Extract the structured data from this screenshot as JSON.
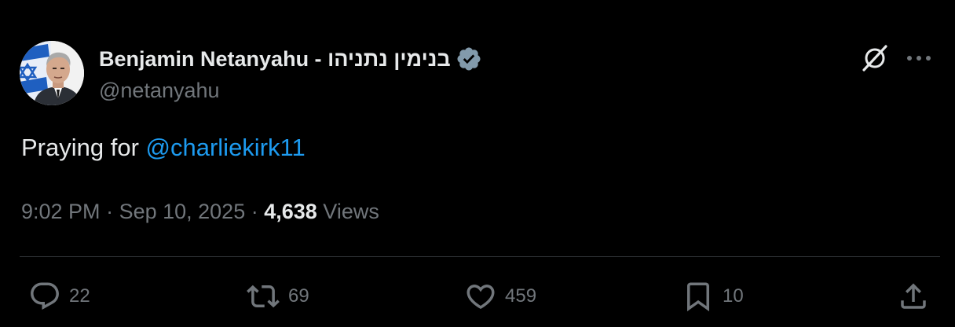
{
  "author": {
    "display_name": "Benjamin Netanyahu - בנימין נתניהו",
    "handle": "@netanyahu",
    "verified_color": "#829aab",
    "avatar_icon": "avatar-photo"
  },
  "tweet": {
    "text_prefix": "Praying for ",
    "mention": "@charliekirk11",
    "time": "9:02 PM",
    "separator1": " · ",
    "date": "Sep 10, 2025",
    "separator2": " · ",
    "views_count": "4,638",
    "views_label": " Views"
  },
  "actions": {
    "replies": "22",
    "reposts": "69",
    "likes": "459",
    "bookmarks": "10"
  },
  "icons": {
    "grok": "grok-icon",
    "more": "more-icon",
    "reply": "reply-icon",
    "repost": "repost-icon",
    "like": "heart-icon",
    "bookmark": "bookmark-icon",
    "share": "share-icon"
  },
  "colors": {
    "background": "#000000",
    "text": "#e7e9ea",
    "secondary": "#71767b",
    "link": "#1d9bf0",
    "divider": "#2f3336"
  }
}
